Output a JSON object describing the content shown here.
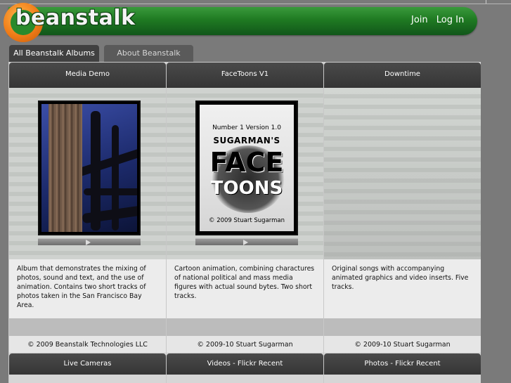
{
  "header": {
    "logo_text": "beanstalk",
    "links": [
      "Join",
      "Log In"
    ]
  },
  "tabs": [
    {
      "label": "All Beanstalk Albums",
      "active": true
    },
    {
      "label": "About Beanstalk",
      "active": false
    }
  ],
  "albums": [
    {
      "title": "Media Demo",
      "description": "Album that demonstrates the mixing of photos, sound and text, and the use of animation. Contains two short tracks of photos taken in the San Francisco Bay Area.",
      "copyright": "© 2009 Beanstalk Technologies LLC"
    },
    {
      "title": "FaceToons V1",
      "description": "Cartoon animation, combining charactures of national political and mass media figures with actual sound bytes. Two short tracks.",
      "copyright": "© 2009-10 Stuart Sugarman",
      "cover": {
        "line1": "Number 1  Version 1.0",
        "brand": "SUGARMAN'S",
        "big1": "FACE",
        "big2": "TOONS",
        "copy": "© 2009 Stuart Sugarman"
      }
    },
    {
      "title": "Downtime",
      "description": "Original songs with accompanying animated graphics and video inserts. Five tracks.",
      "copyright": "© 2009-10 Stuart Sugarman"
    }
  ],
  "albums_row2": [
    {
      "title": "Live Cameras"
    },
    {
      "title": "Videos - Flickr Recent"
    },
    {
      "title": "Photos - Flickr Recent"
    }
  ],
  "colors": {
    "header_green": "#1f7a22",
    "logo_orange": "#f07c18",
    "card_header": "#404040"
  }
}
